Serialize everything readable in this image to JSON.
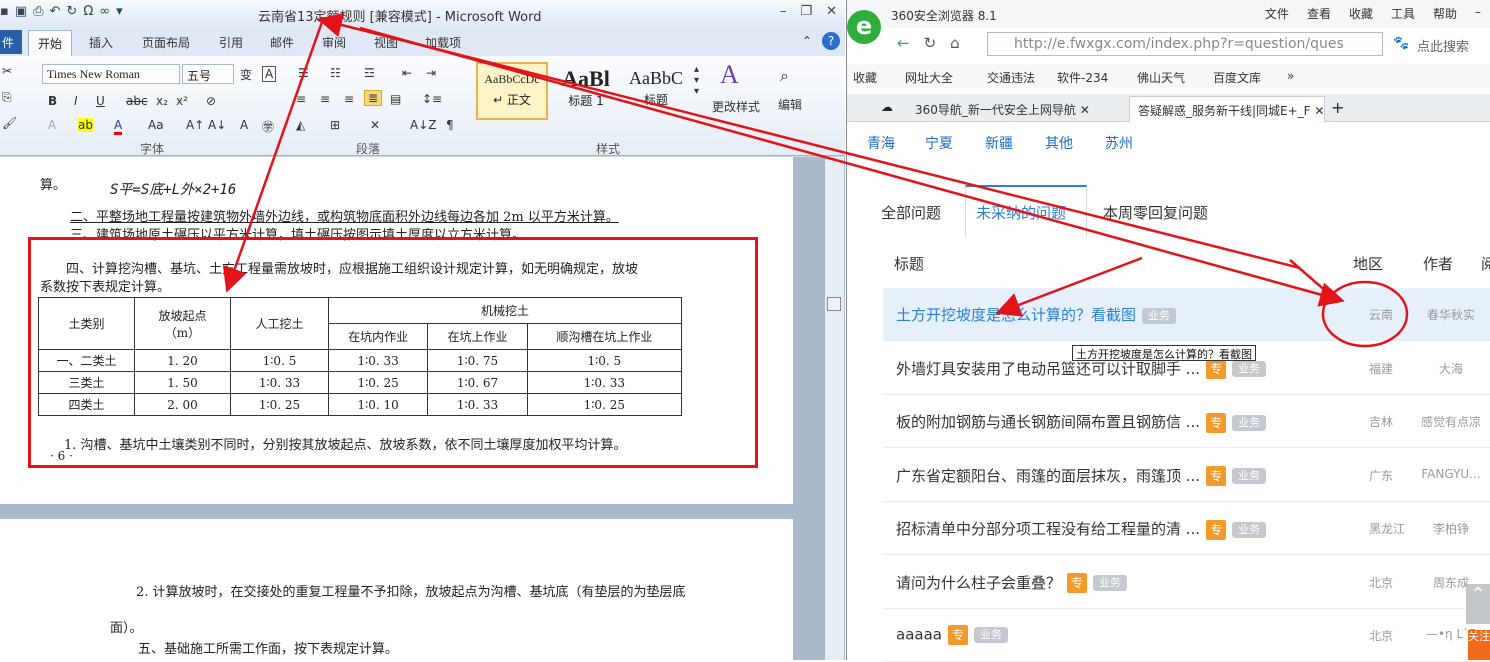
{
  "word": {
    "title": "云南省13定额规则 [兼容模式] - Microsoft Word",
    "tabs": [
      "开始",
      "插入",
      "页面布局",
      "引用",
      "邮件",
      "审阅",
      "视图",
      "加载项"
    ],
    "file_tab": "件",
    "font_name": "Times New Roman",
    "font_size": "五号",
    "group_labels": {
      "font": "字体",
      "paragraph": "段落",
      "styles": "样式"
    },
    "styles": [
      {
        "preview": "AaBbCcDc",
        "name": "↵ 正文"
      },
      {
        "preview": "AaBl",
        "name": "标题 1"
      },
      {
        "preview": "AaBbC",
        "name": "标题"
      }
    ],
    "change_styles": "更改样式",
    "edit": "编辑",
    "doc": {
      "line0": "算。",
      "handwriting": "S平=S底+L外×2+16",
      "line1": "二、平整场地工程量按建筑物外墙外边线，或构筑物底面积外边线每边各加 2m 以平方米计算。",
      "line2": "三、建筑场地原土碾压以平方米计算，填土碾压按图示填土厚度以立方米计算。",
      "line3": "四、计算挖沟槽、基坑、土方工程量需放坡时，应根据施工组织设计规定计算，如无明确规定，放坡",
      "line4": "系数按下表规定计算。",
      "table": {
        "h_soil": "土类别",
        "h_start": "放坡起点",
        "h_unit": "（m）",
        "h_manual": "人工挖土",
        "h_mech": "机械挖土",
        "h_sub": [
          "在坑内作业",
          "在坑上作业",
          "顺沟槽在坑上作业"
        ],
        "rows": [
          [
            "一、二类土",
            "1. 20",
            "1∶0. 5",
            "1∶0. 33",
            "1∶0. 75",
            "1∶0. 5"
          ],
          [
            "三类土",
            "1. 50",
            "1∶0. 33",
            "1∶0. 25",
            "1∶0. 67",
            "1∶0. 33"
          ],
          [
            "四类土",
            "2. 00",
            "1∶0. 25",
            "1∶0. 10",
            "1∶0. 33",
            "1∶0. 25"
          ]
        ]
      },
      "note1": "1. 沟槽、基坑中土壤类别不同时，分别按其放坡起点、放坡系数，依不同土壤厚度加权平均计算。",
      "page_no": "· 6 ·",
      "p2_line1": "2. 计算放坡时，在交接处的重复工程量不予扣除，放坡起点为沟槽、基坑底（有垫层的为垫层底",
      "p2_line2": "面）。",
      "p2_line3": "五、基础施工所需工作面，按下表规定计算。"
    }
  },
  "browser": {
    "name": "360安全浏览器 8.1",
    "menu": [
      "文件",
      "查看",
      "收藏",
      "工具",
      "帮助"
    ],
    "url": "http://e.fwxgx.com/index.php?r=question/ques",
    "search_placeholder": "点此搜索",
    "favorites": [
      "收藏",
      "网址大全",
      "交通违法",
      "软件-234",
      "佛山天气",
      "百度文库"
    ],
    "tabs": [
      "360导航_新一代安全上网导航",
      "答疑解惑_服务新干线|同城E+_F"
    ],
    "provinces": [
      "青海",
      "宁夏",
      "新疆",
      "其他",
      "苏州"
    ],
    "question_tabs": [
      "全部问题",
      "未采纳的问题",
      "本周零回复问题"
    ],
    "headers": {
      "title": "标题",
      "region": "地区",
      "author": "作者",
      "extra": "阅"
    },
    "tooltip": "土方开挖坡度是怎么计算的？看截图",
    "questions": [
      {
        "title": "土方开挖坡度是怎么计算的？看截图",
        "zhuan": "",
        "ye": "业务",
        "region": "云南",
        "author": "春华秋实"
      },
      {
        "title": "外墙灯具安装用了电动吊篮还可以计取脚手 ...",
        "zhuan": "专",
        "ye": "业务",
        "region": "福建",
        "author": "大海"
      },
      {
        "title": "板的附加钢筋与通长钢筋间隔布置且钢筋信 ...",
        "zhuan": "专",
        "ye": "业务",
        "region": "吉林",
        "author": "感觉有点凉"
      },
      {
        "title": "广东省定额阳台、雨篷的面层抹灰，雨篷顶 ...",
        "zhuan": "专",
        "ye": "业务",
        "region": "广东",
        "author": "FANGYU..."
      },
      {
        "title": "招标清单中分部分项工程没有给工程量的清 ...",
        "zhuan": "专",
        "ye": "业务",
        "region": "黑龙江",
        "author": "李柏铮"
      },
      {
        "title": "请问为什么柱子会重叠？",
        "zhuan": "专",
        "ye": "业务",
        "region": "北京",
        "author": "周东成"
      },
      {
        "title": "aaaaa",
        "zhuan": "专",
        "ye": "业务",
        "region": "北京",
        "author": "—•η L`F"
      }
    ],
    "follow": "关注"
  },
  "colors": {
    "annotation_red": "#e3131a",
    "link_blue": "#2b7fd6",
    "badge_orange": "#f39a2b"
  }
}
